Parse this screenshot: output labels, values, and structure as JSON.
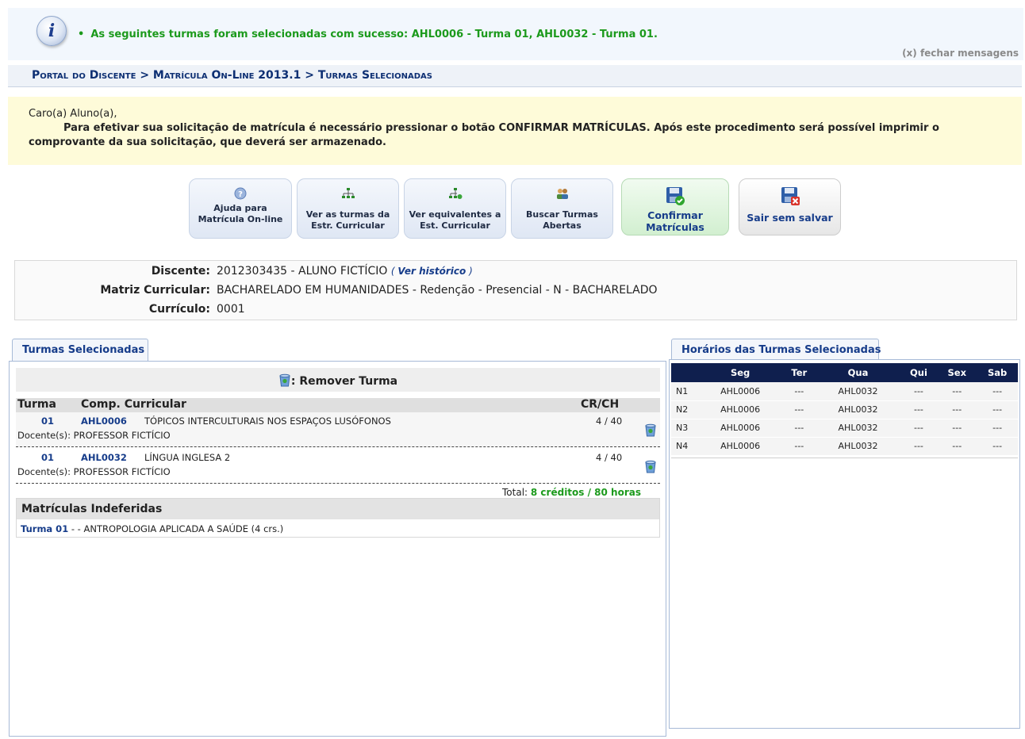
{
  "message": {
    "text": "As seguintes turmas foram selecionadas com sucesso: AHL0006 - Turma 01, AHL0032 - Turma 01.",
    "close_label": "(x) fechar mensagens"
  },
  "breadcrumb": "Portal do Discente > Matrícula On-Line 2013.1 > Turmas Selecionadas",
  "notice": {
    "greeting": "Caro(a) Aluno(a),",
    "body": "Para efetivar sua solicitação de matrícula é necessário pressionar o botão CONFIRMAR MATRÍCULAS. Após este procedimento será possível imprimir o comprovante da sua solicitação, que deverá ser armazenado."
  },
  "actions": {
    "help": "Ajuda para Matrícula On-line",
    "curricular": "Ver as turmas da Estr. Curricular",
    "equivalents": "Ver equivalentes a Est. Curricular",
    "search": "Buscar Turmas Abertas",
    "confirm": "Confirmar Matrículas",
    "exit": "Sair sem salvar"
  },
  "student": {
    "discente_label": "Discente:",
    "discente": "2012303435 - ALUNO FICTÍCIO",
    "historico_open": "( ",
    "historico": "Ver histórico",
    "historico_close": " )",
    "matriz_label": "Matriz Curricular:",
    "matriz": "BACHARELADO EM HUMANIDADES - Redenção - Presencial - N - BACHARELADO",
    "curriculo_label": "Currículo:",
    "curriculo": "0001"
  },
  "tabs": {
    "left": "Turmas Selecionadas",
    "right": "Horários das Turmas Selecionadas"
  },
  "selected": {
    "remove_label": ": Remover Turma",
    "headers": {
      "turma": "Turma",
      "comp": "Comp. Curricular",
      "crch": "CR/CH"
    },
    "rows": [
      {
        "turma": "01",
        "code": "AHL0006",
        "name": "TÓPICOS INTERCULTURAIS NOS ESPAÇOS LUSÓFONOS",
        "crch": "4 / 40",
        "docente": "Docente(s): PROFESSOR FICTÍCIO"
      },
      {
        "turma": "01",
        "code": "AHL0032",
        "name": "LÍNGUA INGLESA 2",
        "crch": "4 / 40",
        "docente": "Docente(s): PROFESSOR FICTÍCIO"
      }
    ],
    "total_label": "Total: ",
    "total_value": "8 créditos / 80 horas"
  },
  "indeferidas": {
    "title": "Matrículas Indeferidas",
    "turma": "Turma 01",
    "text": " - - ANTROPOLOGIA APLICADA A SAÚDE (4 crs.)"
  },
  "schedule": {
    "days": [
      "Seg",
      "Ter",
      "Qua",
      "Qui",
      "Sex",
      "Sab"
    ],
    "rows": [
      {
        "h": "N1",
        "cells": [
          "AHL0006",
          "---",
          "AHL0032",
          "---",
          "---",
          "---"
        ]
      },
      {
        "h": "N2",
        "cells": [
          "AHL0006",
          "---",
          "AHL0032",
          "---",
          "---",
          "---"
        ]
      },
      {
        "h": "N3",
        "cells": [
          "AHL0006",
          "---",
          "AHL0032",
          "---",
          "---",
          "---"
        ]
      },
      {
        "h": "N4",
        "cells": [
          "AHL0006",
          "---",
          "AHL0032",
          "---",
          "---",
          "---"
        ]
      }
    ]
  },
  "colors": {
    "accent": "#163c8a",
    "success": "#1c9a1c",
    "header_dark": "#0f1f4e",
    "notice_bg": "#fefbd9"
  }
}
